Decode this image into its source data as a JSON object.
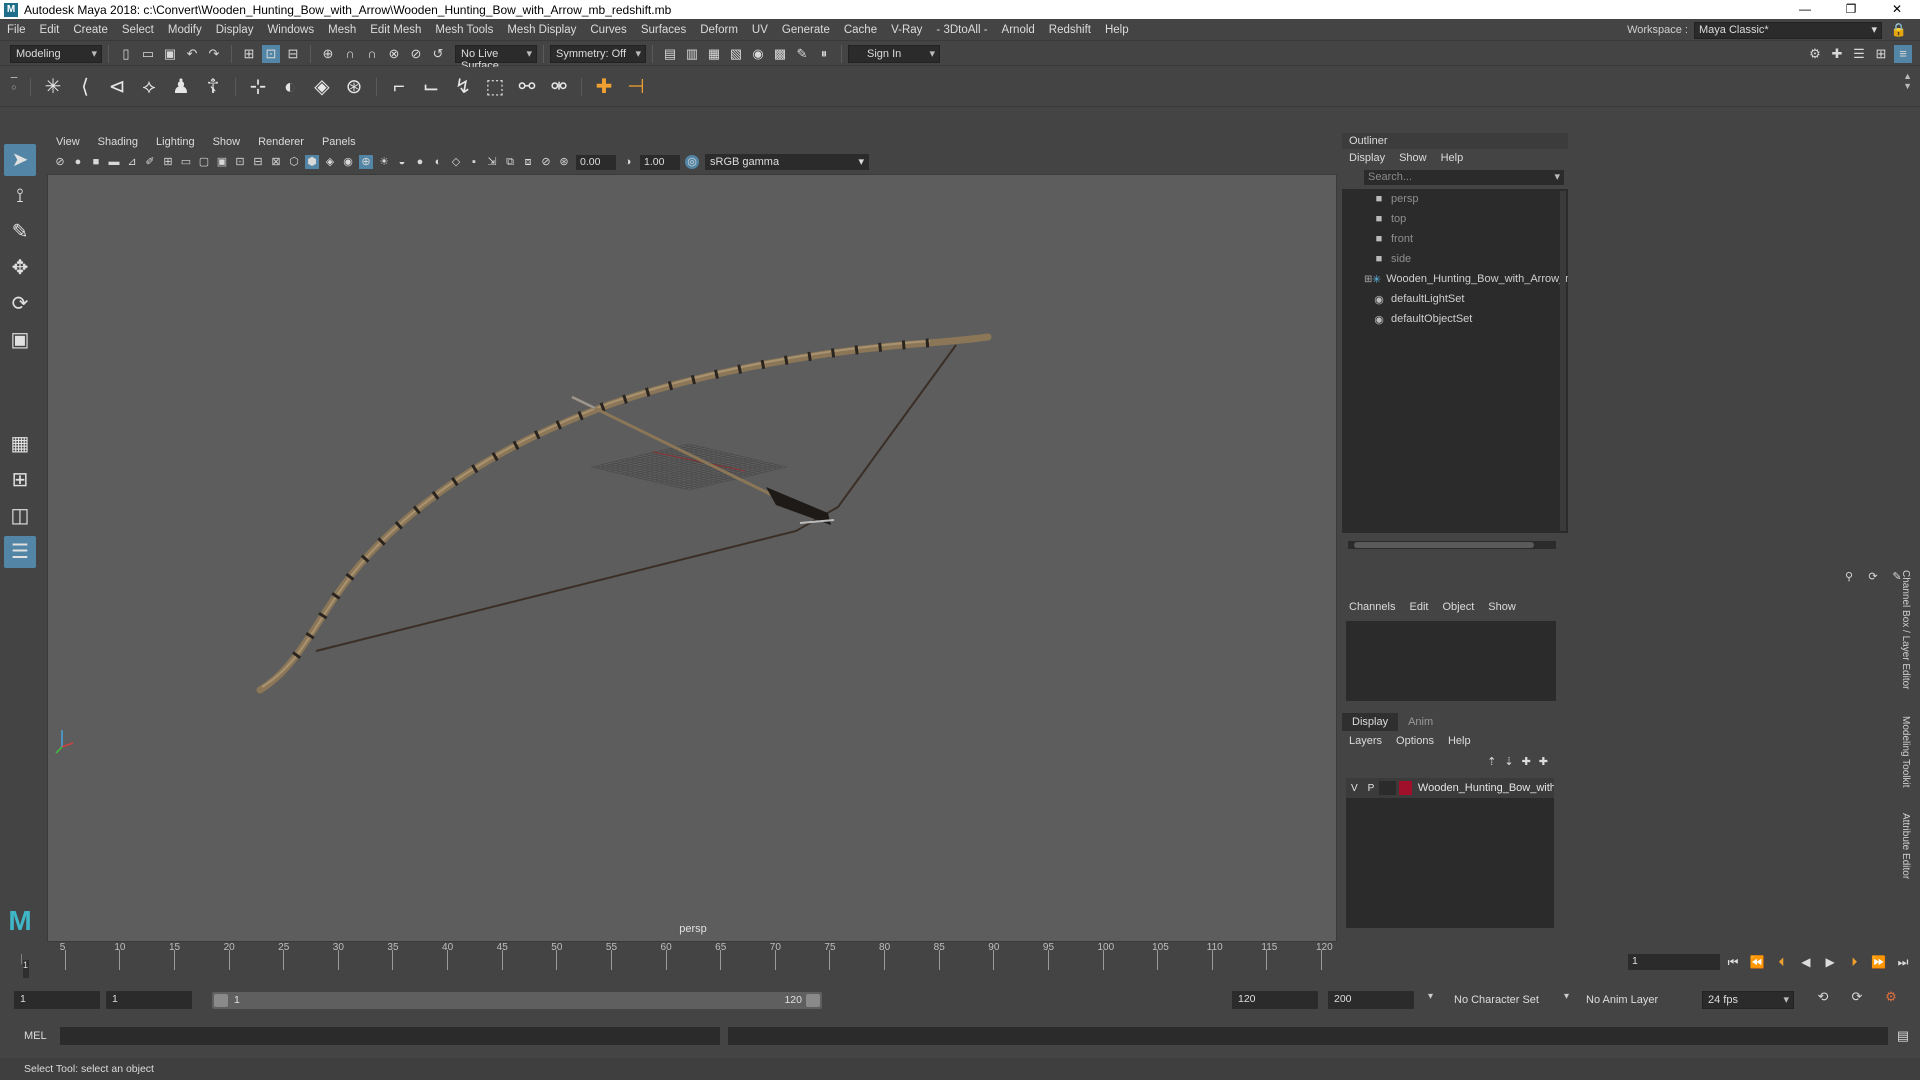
{
  "window": {
    "title": "Autodesk Maya 2018: c:\\Convert\\Wooden_Hunting_Bow_with_Arrow\\Wooden_Hunting_Bow_with_Arrow_mb_redshift.mb",
    "app_icon": "M",
    "minimize": "—",
    "maximize": "❐",
    "close": "✕"
  },
  "menubar": {
    "items": [
      "File",
      "Edit",
      "Create",
      "Select",
      "Modify",
      "Display",
      "Windows",
      "Mesh",
      "Edit Mesh",
      "Mesh Tools",
      "Mesh Display",
      "Curves",
      "Surfaces",
      "Deform",
      "UV",
      "Generate",
      "Cache",
      "V-Ray",
      "- 3DtoAll -",
      "Arnold",
      "Redshift",
      "Help"
    ],
    "workspace_label": "Workspace :",
    "workspace_value": "Maya Classic*"
  },
  "statusline": {
    "mode": "Modeling",
    "live_surface": "No Live Surface",
    "symmetry": "Symmetry: Off",
    "sign_in": "Sign In"
  },
  "viewport": {
    "menu": [
      "View",
      "Shading",
      "Lighting",
      "Show",
      "Renderer",
      "Panels"
    ],
    "exposure": "0.00",
    "gamma": "1.00",
    "color_space": "sRGB gamma",
    "camera_label": "persp"
  },
  "outliner": {
    "title": "Outliner",
    "menu": [
      "Display",
      "Show",
      "Help"
    ],
    "search_placeholder": "Search...",
    "items": [
      {
        "label": "persp",
        "type": "camera"
      },
      {
        "label": "top",
        "type": "camera"
      },
      {
        "label": "front",
        "type": "camera"
      },
      {
        "label": "side",
        "type": "camera"
      },
      {
        "label": "Wooden_Hunting_Bow_with_Arrow_ncl",
        "type": "group"
      },
      {
        "label": "defaultLightSet",
        "type": "set"
      },
      {
        "label": "defaultObjectSet",
        "type": "set"
      }
    ]
  },
  "channelbox": {
    "menu": [
      "Channels",
      "Edit",
      "Object",
      "Show"
    ]
  },
  "layer_editor": {
    "tabs": [
      "Display",
      "Anim"
    ],
    "menu": [
      "Layers",
      "Options",
      "Help"
    ],
    "layer": {
      "v": "V",
      "p": "P",
      "name": "Wooden_Hunting_Bow_with_",
      "color": "#a0102a"
    }
  },
  "side_tabs": [
    "Channel Box / Layer Editor",
    "Modeling Toolkit",
    "Attribute Editor"
  ],
  "timeline": {
    "start": 1,
    "end": 120,
    "labels": [
      5,
      10,
      15,
      20,
      25,
      30,
      35,
      40,
      45,
      50,
      55,
      60,
      65,
      70,
      75,
      80,
      85,
      90,
      95,
      100,
      105,
      110,
      115,
      120
    ],
    "current_frame": "1",
    "cursor_label": "1"
  },
  "range": {
    "start_field": "1",
    "start_range": "1",
    "slider_low": "1",
    "slider_high": "120",
    "end_range": "120",
    "end_field": "200",
    "character_set": "No Character Set",
    "anim_layer": "No Anim Layer",
    "fps": "24 fps"
  },
  "command_line": {
    "language": "MEL"
  },
  "help_line": "Select Tool: select an object"
}
